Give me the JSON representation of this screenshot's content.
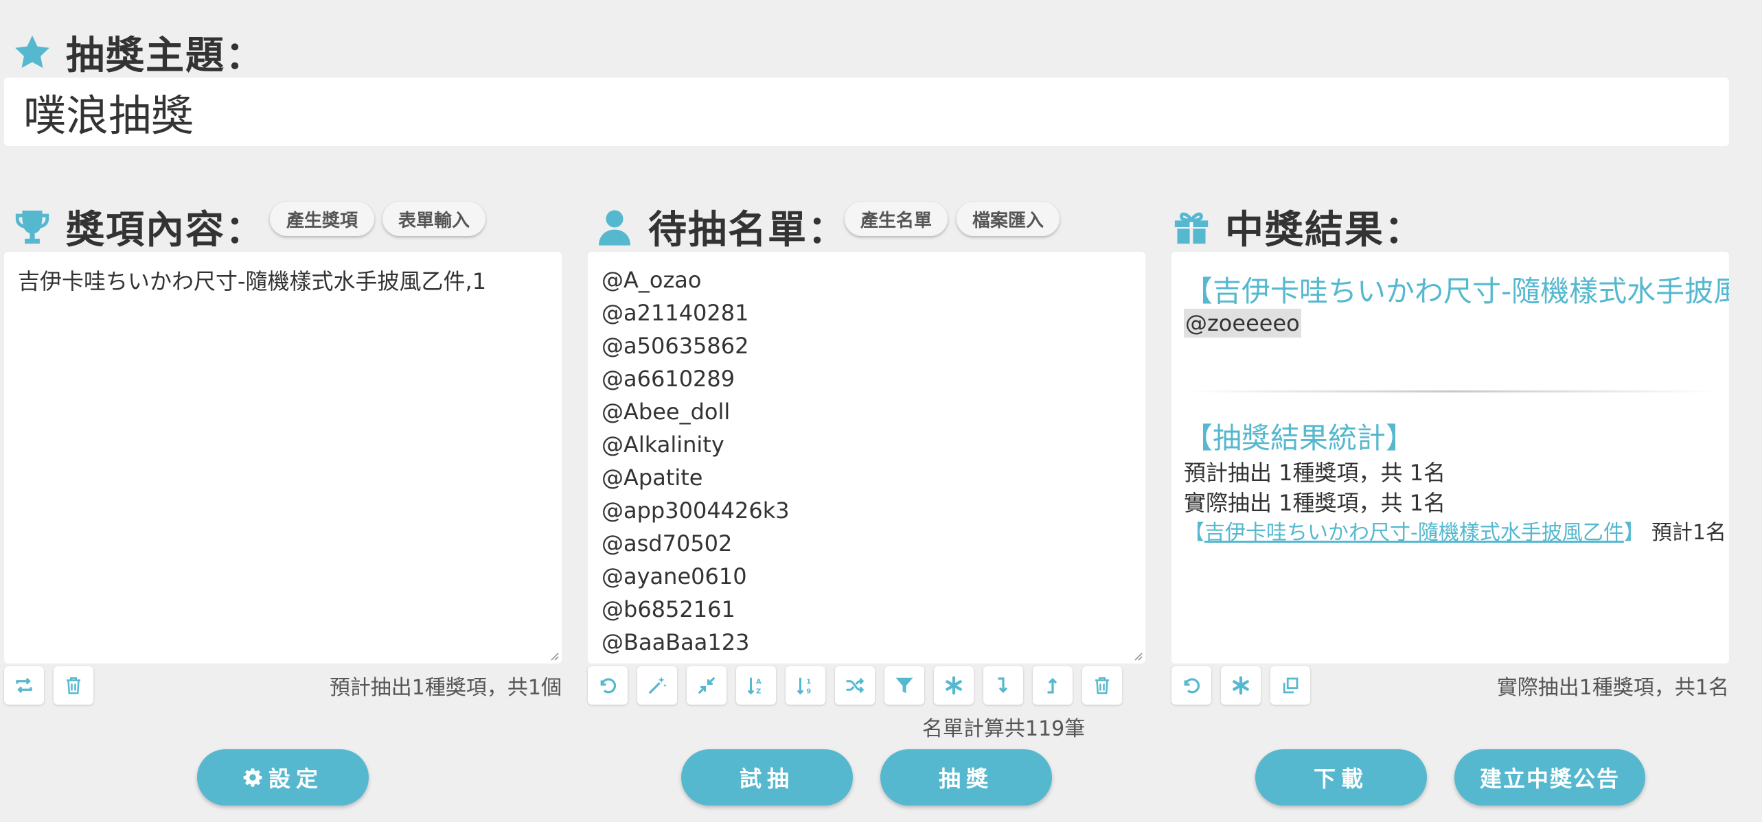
{
  "theme": {
    "heading": "抽獎主題：",
    "value": "噗浪抽獎",
    "icon": "star-icon"
  },
  "prizes": {
    "heading": "獎項內容：",
    "icon": "trophy-icon",
    "buttons": [
      "產生獎項",
      "表單輸入"
    ],
    "content": "吉伊卡哇ちいかわ尺寸-隨機樣式水手披風乙件,1",
    "status": "預計抽出1種獎項，共1個",
    "tools": [
      "sync-icon",
      "trash-icon"
    ]
  },
  "entrants": {
    "heading": "待抽名單：",
    "icon": "user-icon",
    "buttons": [
      "產生名單",
      "檔案匯入"
    ],
    "names": [
      "@A_ozao",
      "@a21140281",
      "@a50635862",
      "@a6610289",
      "@Abee_doll",
      "@Alkalinity",
      "@Apatite",
      "@app3004426k3",
      "@asd70502",
      "@ayane0610",
      "@b6852161",
      "@BaaBaa123"
    ],
    "count": "名單計算共119筆",
    "tools": [
      "undo-icon",
      "magic-wand-icon",
      "compress-icon",
      "sort-alpha-icon",
      "sort-numeric-icon",
      "shuffle-icon",
      "filter-icon",
      "asterisk-icon",
      "arrow-down-icon",
      "arrow-up-icon",
      "trash-icon"
    ]
  },
  "results": {
    "heading": "中獎結果：",
    "icon": "gift-icon",
    "prize_title": "【吉伊卡哇ちいかわ尺寸-隨機樣式水手披風乙件】",
    "winner": "@zoeeeeo",
    "stats_title": "【抽獎結果統計】",
    "stats_expected": "預計抽出 1種獎項，共 1名",
    "stats_actual": "實際抽出 1種獎項，共 1名",
    "stats_item_open": "【",
    "stats_item_link": "吉伊卡哇ちいかわ尺寸-隨機樣式水手披風乙件",
    "stats_item_close": "】",
    "stats_item_tail": "預計1名",
    "status": "實際抽出1種獎項，共1名",
    "tools": [
      "undo-icon",
      "asterisk-icon",
      "copy-icon"
    ]
  },
  "actions": {
    "settings": "設定",
    "trial": "試抽",
    "draw": "抽獎",
    "download": "下載",
    "announce": "建立中獎公告"
  },
  "colors": {
    "accent": "#55b8cf",
    "background": "#efefef",
    "text": "#333333"
  }
}
